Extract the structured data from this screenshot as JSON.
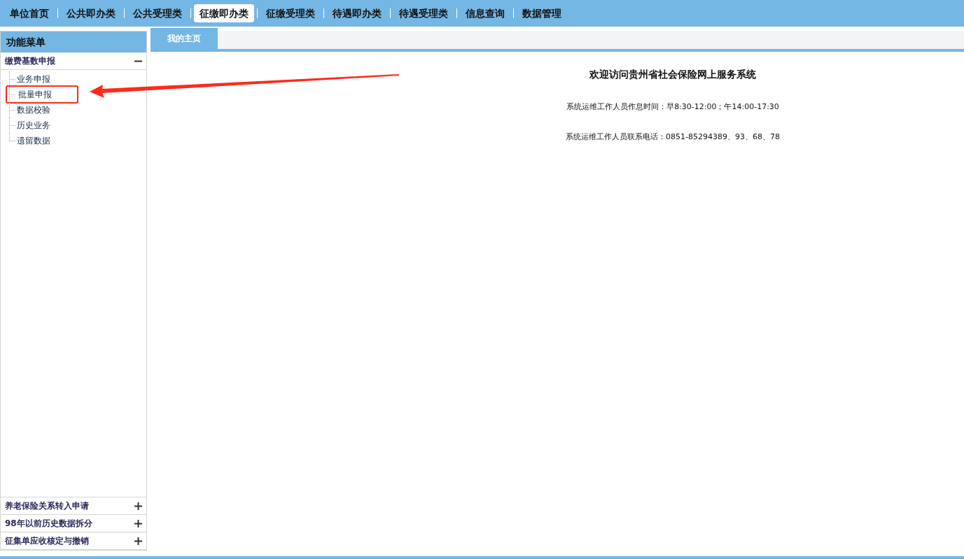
{
  "nav": [
    {
      "label": "单位首页",
      "selected": false
    },
    {
      "label": "公共即办类",
      "selected": false
    },
    {
      "label": "公共受理类",
      "selected": false
    },
    {
      "label": "征缴即办类",
      "selected": true
    },
    {
      "label": "征缴受理类",
      "selected": false
    },
    {
      "label": "待遇即办类",
      "selected": false
    },
    {
      "label": "待遇受理类",
      "selected": false
    },
    {
      "label": "信息查询",
      "selected": false
    },
    {
      "label": "数据管理",
      "selected": false
    }
  ],
  "sidebar": {
    "title": "功能菜单",
    "sections": [
      {
        "label": "缴费基数申报",
        "expanded": true,
        "items": [
          {
            "label": "业务申报",
            "highlighted": false
          },
          {
            "label": "批量申报",
            "highlighted": true
          },
          {
            "label": "数据校验",
            "highlighted": false
          },
          {
            "label": "历史业务",
            "highlighted": false
          },
          {
            "label": "遗留数据",
            "highlighted": false
          }
        ]
      },
      {
        "label": "养老保险关系转入申请",
        "expanded": false
      },
      {
        "label": "98年以前历史数据拆分",
        "expanded": false
      },
      {
        "label": "征集单应收核定与撤销",
        "expanded": false
      }
    ]
  },
  "tabs": [
    {
      "label": "我的主页",
      "selected": true
    }
  ],
  "content": {
    "title": "欢迎访问贵州省社会保险网上服务系统",
    "lines": [
      "系统运维工作人员作息时间：早8:30-12:00；午14:00-17:30",
      "系统运维工作人员联系电话：0851-85294389、93、68、78"
    ]
  }
}
